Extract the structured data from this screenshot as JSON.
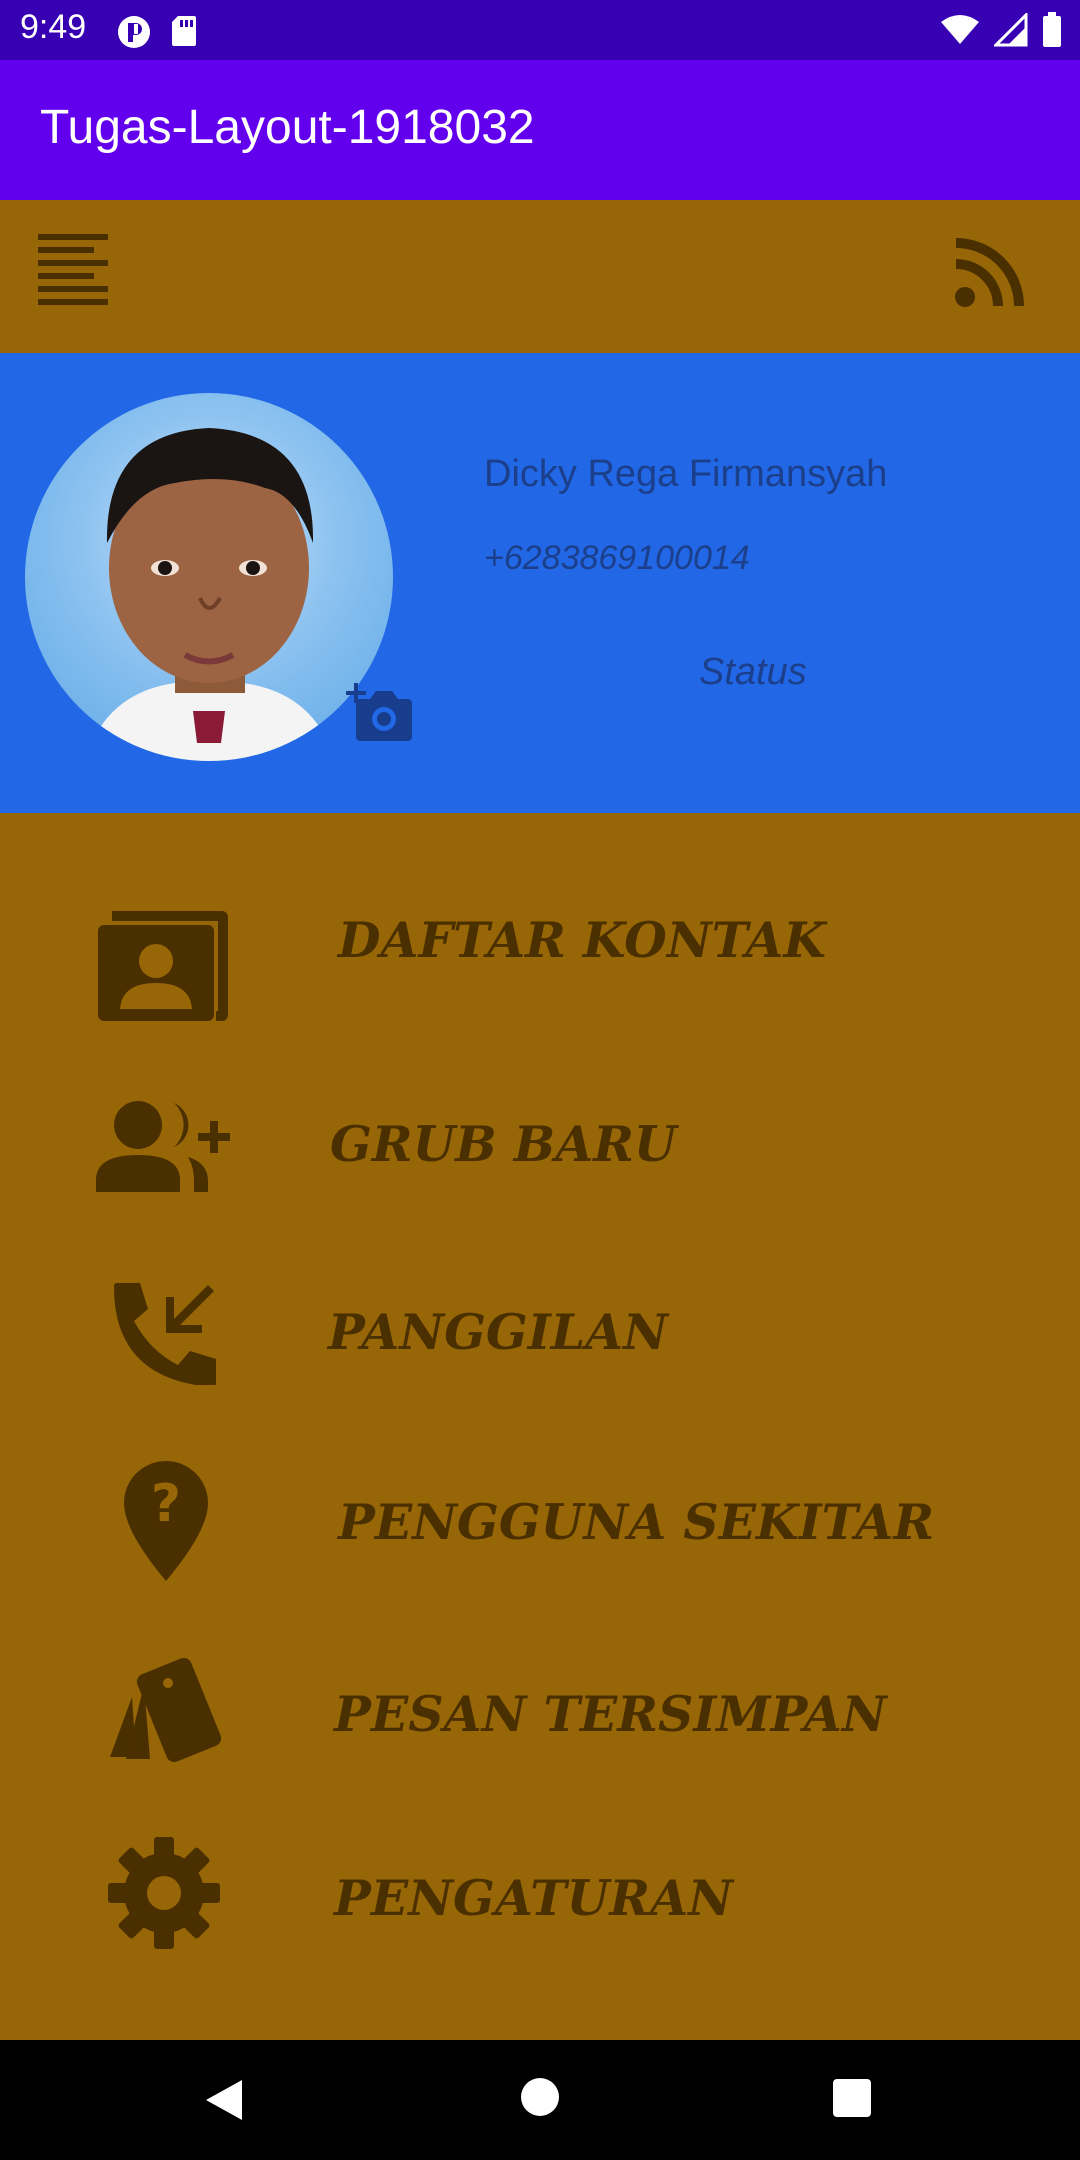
{
  "status_bar": {
    "time": "9:49",
    "icons": [
      "notification-icon",
      "sd-card-icon",
      "wifi-icon",
      "signal-icon",
      "battery-icon"
    ]
  },
  "app_bar": {
    "title": "Tugas-Layout-1918032"
  },
  "toolbar": {
    "left_icon": "menu-lines-icon",
    "right_icon": "rss-feed-icon"
  },
  "profile": {
    "name": "Dicky Rega Firmansyah",
    "phone": "+6283869100014",
    "status": "Status",
    "camera_icon": "add-camera-icon"
  },
  "menu": {
    "items": [
      {
        "label": "DAFTAR KONTAK",
        "icon": "contact-card-icon"
      },
      {
        "label": "GRUB BARU",
        "icon": "group-add-icon"
      },
      {
        "label": "PANGGILAN",
        "icon": "call-received-icon"
      },
      {
        "label": "PENGGUNA SEKITAR",
        "icon": "location-question-icon"
      },
      {
        "label": "PESAN TERSIMPAN",
        "icon": "saved-cards-icon"
      },
      {
        "label": "PENGATURAN",
        "icon": "settings-gear-icon"
      }
    ]
  },
  "colors": {
    "status_bar": "#3700b3",
    "app_bar": "#6200ee",
    "background": "#966607",
    "profile_bg": "#2267e6",
    "icon_dark": "#4a2f00",
    "profile_text": "#1b3f8a"
  }
}
